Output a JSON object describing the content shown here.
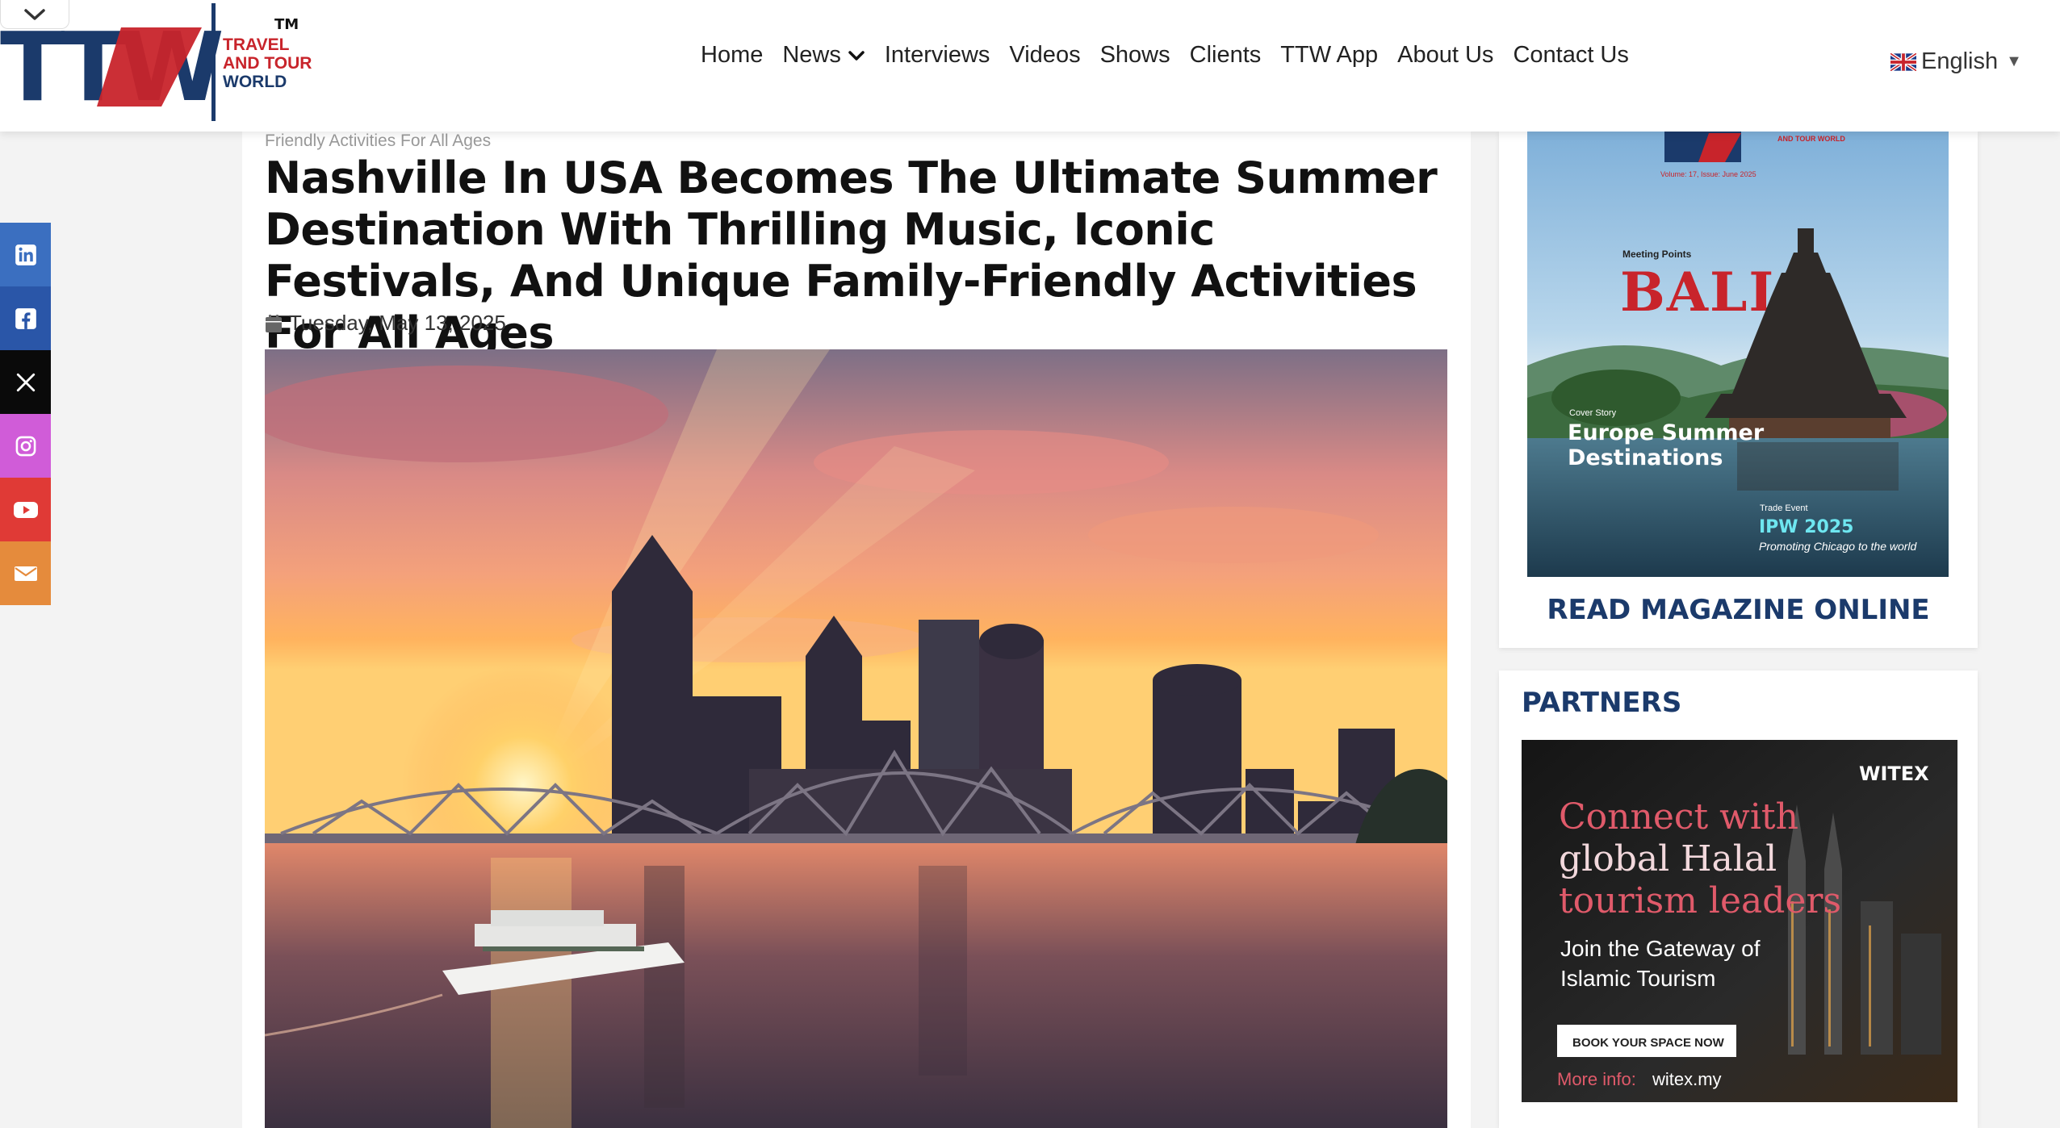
{
  "header": {
    "logo_letters": "TTW",
    "logo_tm": "TM",
    "logo_line1": "TRAVEL",
    "logo_line2": "AND TOUR",
    "logo_line3": "WORLD",
    "nav": [
      {
        "label": "Home"
      },
      {
        "label": "News"
      },
      {
        "label": "Interviews"
      },
      {
        "label": "Videos"
      },
      {
        "label": "Shows"
      },
      {
        "label": "Clients"
      },
      {
        "label": "TTW App"
      },
      {
        "label": "About Us"
      },
      {
        "label": "Contact Us"
      }
    ],
    "language": "English"
  },
  "social": [
    {
      "name": "linkedin",
      "color": "#3b6fc0"
    },
    {
      "name": "facebook",
      "color": "#2a56a8"
    },
    {
      "name": "x",
      "color": "#0a0a0a"
    },
    {
      "name": "instagram",
      "color": "#d05cd8"
    },
    {
      "name": "youtube",
      "color": "#e03a36"
    },
    {
      "name": "email",
      "color": "#e58b3c"
    }
  ],
  "article": {
    "breadcrumb": "Friendly Activities For All Ages",
    "title": "Nashville In USA Becomes The Ultimate Summer Destination With Thrilling Music, Iconic Festivals, And Unique Family-Friendly Activities For All Ages",
    "date": "Tuesday, May 13, 2025"
  },
  "magazine": {
    "masthead_sub": "AND TOUR WORLD",
    "volume": "Volume: 17, Issue: June 2025",
    "meeting_points": "Meeting Points",
    "destination": "BALI",
    "cover_story_label": "Cover Story",
    "cover_story_line1": "Europe Summer",
    "cover_story_line2": "Destinations",
    "trade_event_label": "Trade Event",
    "trade_event_name": "IPW 2025",
    "trade_event_tagline": "Promoting Chicago to the world",
    "read_online": "READ MAGAZINE ONLINE"
  },
  "partners": {
    "title": "PARTNERS",
    "ad": {
      "brand": "WITEX",
      "line1": "Connect with",
      "line2": "global Halal",
      "line3": "tourism leaders",
      "sub1": "Join the Gateway of",
      "sub2": "Islamic Tourism",
      "cta": "BOOK YOUR SPACE NOW",
      "more_label": "More info:",
      "more_url": "witex.my"
    }
  },
  "colors": {
    "brand_navy": "#1b3a6b",
    "brand_red": "#c8242b"
  }
}
